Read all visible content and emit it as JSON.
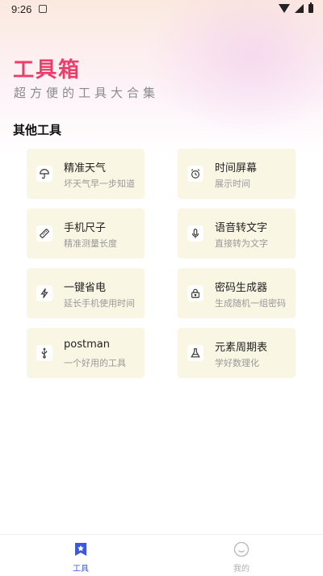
{
  "status_bar": {
    "time": "9:26"
  },
  "header": {
    "title": "工具箱",
    "subtitle": "超方便的工具大合集"
  },
  "section": {
    "title": "其他工具"
  },
  "tools": [
    {
      "name": "精准天气",
      "desc": "坏天气早一步知道",
      "icon": "umbrella-icon"
    },
    {
      "name": "时间屏幕",
      "desc": "展示时间",
      "icon": "alarm-clock-icon"
    },
    {
      "name": "手机尺子",
      "desc": "精准测量长度",
      "icon": "ruler-icon"
    },
    {
      "name": "语音转文字",
      "desc": "直接转为文字",
      "icon": "microphone-icon"
    },
    {
      "name": "一键省电",
      "desc": "延长手机使用时间",
      "icon": "lightning-icon"
    },
    {
      "name": "密码生成器",
      "desc": "生成随机一组密码",
      "icon": "lock-icon"
    },
    {
      "name": "postman",
      "desc": "一个好用的工具",
      "icon": "usb-icon"
    },
    {
      "name": "元素周期表",
      "desc": "学好数理化",
      "icon": "flask-icon"
    }
  ],
  "bottom_nav": [
    {
      "label": "工具",
      "icon": "star-bookmark-icon",
      "active": true
    },
    {
      "label": "我的",
      "icon": "smile-icon",
      "active": false
    }
  ],
  "colors": {
    "title": "#ec3e6b",
    "card_bg": "#faf6e4",
    "nav_active": "#3a57e8",
    "nav_inactive": "#b0b0b0"
  }
}
